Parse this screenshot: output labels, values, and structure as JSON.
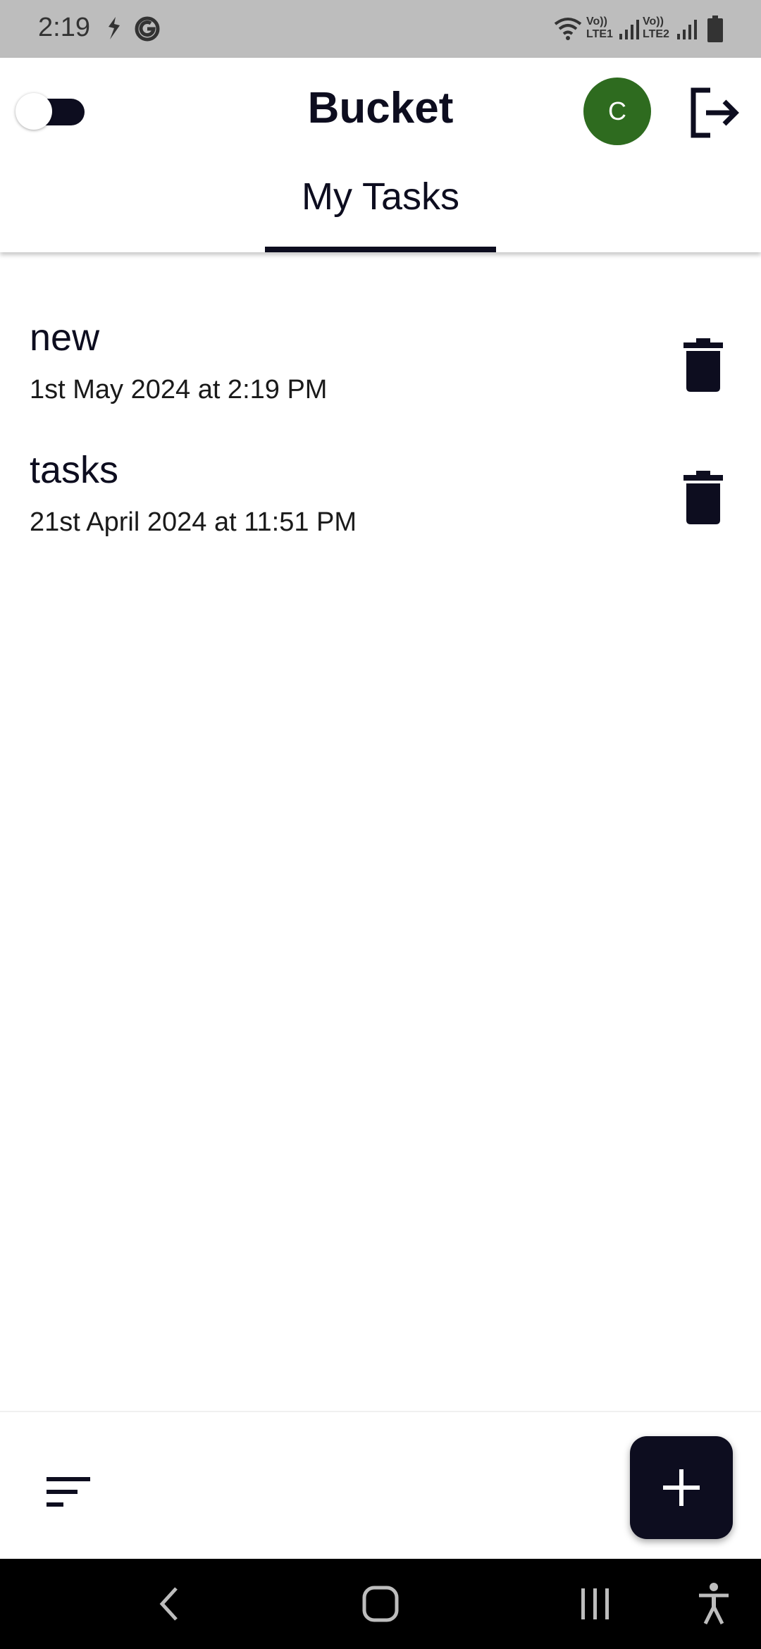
{
  "status_bar": {
    "time": "2:19",
    "icons": [
      "kite-icon",
      "g-circle-icon",
      "wifi-icon",
      "volte-lte1-icon",
      "signal-icon",
      "volte-lte2-icon",
      "signal-icon",
      "battery-icon"
    ],
    "network_labels": [
      "Vo))",
      "LTE1",
      "Vo))",
      "LTE2"
    ]
  },
  "app_bar": {
    "title": "Bucket",
    "avatar_initial": "C",
    "toggle_on": false,
    "tabs": [
      {
        "label": "My Tasks",
        "selected": true
      }
    ]
  },
  "tasks": [
    {
      "title": "new",
      "date": "1st May 2024 at 2:19 PM"
    },
    {
      "title": "tasks",
      "date": "21st April 2024 at 11:51 PM"
    }
  ],
  "bottom_bar": {
    "sort_icon": "sort-icon",
    "add_icon": "plus-icon"
  },
  "colors": {
    "primary": "#0d0d1f",
    "avatar_bg": "#2e6b1f",
    "status_bar_bg": "#bdbdbd"
  },
  "nav_bar": {
    "buttons": [
      "back-icon",
      "home-icon",
      "recents-icon",
      "accessibility-icon"
    ]
  }
}
